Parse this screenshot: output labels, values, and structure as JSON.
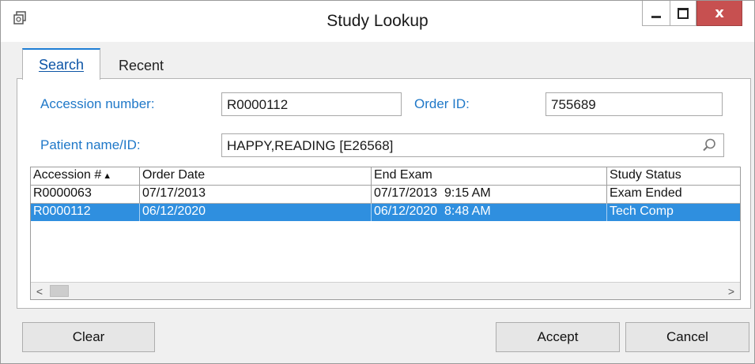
{
  "window": {
    "title": "Study Lookup",
    "minimize_icon": "minimize-icon",
    "maximize_icon": "maximize-icon",
    "close_glyph": "x",
    "app_icon": "window-restore-icon"
  },
  "tabs": [
    {
      "label": "Search",
      "selected": true
    },
    {
      "label": "Recent",
      "selected": false
    }
  ],
  "form": {
    "accession_label": "Accession number:",
    "accession_value": "R0000112",
    "order_id_label": "Order ID:",
    "order_id_value": "755689",
    "patient_label": "Patient name/ID:",
    "patient_value": "HAPPY,READING [E26568]",
    "patient_search_icon": "search-icon"
  },
  "grid": {
    "columns": [
      "Accession #",
      "Order Date",
      "End Exam",
      "Study Status"
    ],
    "sort_indicator": "▲",
    "rows": [
      {
        "accession": "R0000063",
        "order_date": "07/17/2013",
        "end_exam": "07/17/2013  9:15 AM",
        "status": "Exam Ended",
        "selected": false
      },
      {
        "accession": "R0000112",
        "order_date": "06/12/2020",
        "end_exam": "06/12/2020  8:48 AM",
        "status": "Tech Comp",
        "selected": true
      }
    ],
    "scroll_left_glyph": "<",
    "scroll_right_glyph": ">"
  },
  "buttons": {
    "clear": "Clear",
    "accept": "Accept",
    "cancel": "Cancel"
  },
  "colors": {
    "selection": "#2f8fdf",
    "label_blue": "#1f78c8",
    "close_red": "#c75050"
  }
}
